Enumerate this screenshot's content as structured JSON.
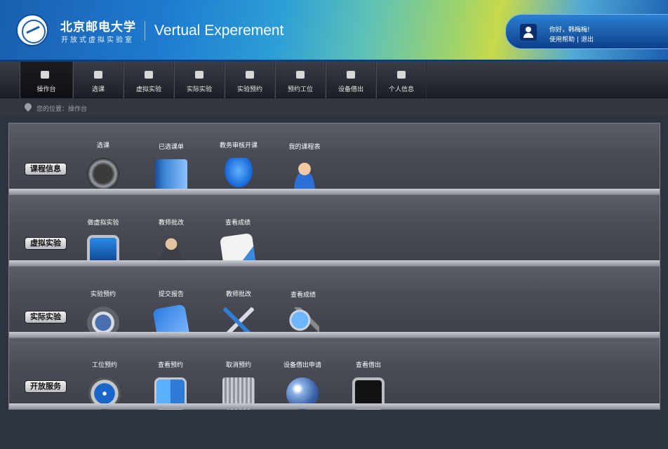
{
  "header": {
    "uni_name": "北京邮电大学",
    "uni_sub": "开放式虚拟实验室",
    "app_title": "Vertual Experement",
    "greeting": "你好，韩梅梅!",
    "help_link": "使用帮助",
    "separator": "|",
    "logout_link": "退出"
  },
  "nav": {
    "items": [
      {
        "label": "操作台",
        "icon": "home-icon"
      },
      {
        "label": "选课",
        "icon": "grid-icon"
      },
      {
        "label": "虚拟实验",
        "icon": "cube-icon"
      },
      {
        "label": "实际实验",
        "icon": "tools-icon"
      },
      {
        "label": "实验预约",
        "icon": "calendar-icon"
      },
      {
        "label": "预约工位",
        "icon": "calendar-icon"
      },
      {
        "label": "设备借出",
        "icon": "book-icon"
      },
      {
        "label": "个人信息",
        "icon": "user-icon"
      }
    ],
    "active": "操作台"
  },
  "breadcrumb": {
    "text": "您的位置：操作台"
  },
  "shelves": [
    {
      "label": "课程信息",
      "items": [
        {
          "label": "选课",
          "icon": "compass-icon"
        },
        {
          "label": "已选课单",
          "icon": "address-book-icon"
        },
        {
          "label": "教务审核开课",
          "icon": "chair-icon"
        },
        {
          "label": "我的课程表",
          "icon": "person-icon"
        }
      ]
    },
    {
      "label": "虚拟实验",
      "items": [
        {
          "label": "做虚拟实验",
          "icon": "monitor-icon"
        },
        {
          "label": "教师批改",
          "icon": "teacher-icon"
        },
        {
          "label": "查看成绩",
          "icon": "document-icon"
        }
      ]
    },
    {
      "label": "实际实验",
      "items": [
        {
          "label": "实验预约",
          "icon": "gauge-icon"
        },
        {
          "label": "提交报告",
          "icon": "blueprint-hammer-icon"
        },
        {
          "label": "教师批改",
          "icon": "tools-icon"
        },
        {
          "label": "查看成绩",
          "icon": "magnifier-icon"
        }
      ]
    },
    {
      "label": "开放服务",
      "items": [
        {
          "label": "工位预约",
          "icon": "info-icon"
        },
        {
          "label": "查看预约",
          "icon": "finder-icon"
        },
        {
          "label": "取消预约",
          "icon": "trash-icon"
        },
        {
          "label": "设备借出申请",
          "icon": "globe-icon"
        },
        {
          "label": "查看借出",
          "icon": "terminal-icon"
        }
      ]
    }
  ]
}
